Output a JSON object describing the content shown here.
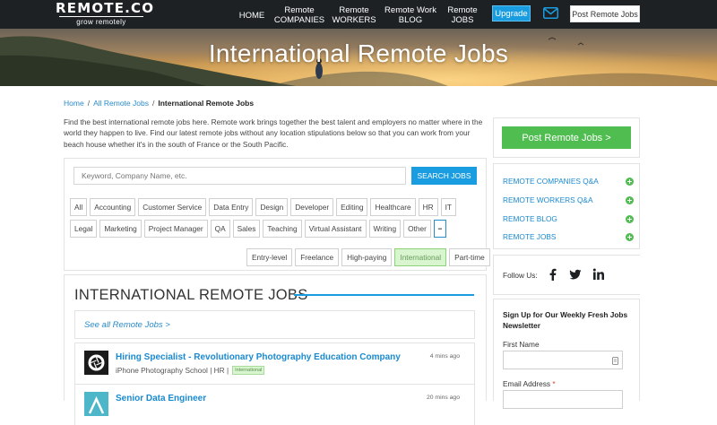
{
  "nav": {
    "logo": "REMOTE.CO",
    "tagline": "grow remotely",
    "home": "HOME",
    "companies": "Remote\nCOMPANIES",
    "workers": "Remote\nWORKERS",
    "blog": "Remote Work\nBLOG",
    "jobs": "Remote\nJOBS",
    "upgrade": "Upgrade",
    "post_jobs": "Post Remote Jobs",
    "mail_icon": "envelope-icon"
  },
  "hero": {
    "title": "International Remote Jobs"
  },
  "breadcrumb": {
    "home": "Home",
    "all_jobs": "All Remote Jobs",
    "current": "International Remote Jobs",
    "separator": "/"
  },
  "intro": "Find the best international remote jobs here. Remote work brings together the best talent and employers no matter where in the world they happen to live. Find our latest remote jobs without any location stipulations below so that you can work from your beach house whether it's in the south of France or the South Pacific.",
  "search": {
    "placeholder": "Keyword, Company Name, etc.",
    "button": "SEARCH JOBS"
  },
  "categories": [
    "All",
    "Accounting",
    "Customer Service",
    "Data Entry",
    "Design",
    "Developer",
    "Editing",
    "Healthcare",
    "HR",
    "IT",
    "Legal",
    "Marketing",
    "Project Manager",
    "QA",
    "Sales",
    "Teaching",
    "Virtual Assistant",
    "Writing",
    "Other"
  ],
  "collapse_label": "−",
  "job_types": [
    {
      "label": "Entry-level",
      "active": false
    },
    {
      "label": "Freelance",
      "active": false
    },
    {
      "label": "High-paying",
      "active": false
    },
    {
      "label": "International",
      "active": true
    },
    {
      "label": "Part-time",
      "active": false
    }
  ],
  "jobs": {
    "heading": "INTERNATIONAL REMOTE JOBS",
    "see_all": "See all Remote Jobs >",
    "listings": [
      {
        "title": "Hiring Specialist - Revolutionary Photography Education Company",
        "company": "iPhone Photography School",
        "category": "HR",
        "separator": "|",
        "badge": "International",
        "time": "4 mins ago"
      },
      {
        "title": "Senior Data Engineer",
        "time": "20 mins ago"
      }
    ]
  },
  "sidebar": {
    "post_button": "Post Remote Jobs >",
    "links": [
      "REMOTE COMPANIES Q&A",
      "REMOTE WORKERS Q&A",
      "REMOTE BLOG",
      "REMOTE JOBS"
    ],
    "follow_label": "Follow Us:",
    "newsletter_title": "Sign Up for Our Weekly Fresh Jobs Newsletter",
    "first_name_label": "First Name",
    "email_label": "Email Address",
    "required_mark": "*"
  },
  "colors": {
    "nav_bg": "#1d2124",
    "accent_blue": "#1a9ce0",
    "link_blue": "#1a8ad0",
    "green": "#4fbd4f",
    "active_tag_bg": "#d8f5cf"
  }
}
